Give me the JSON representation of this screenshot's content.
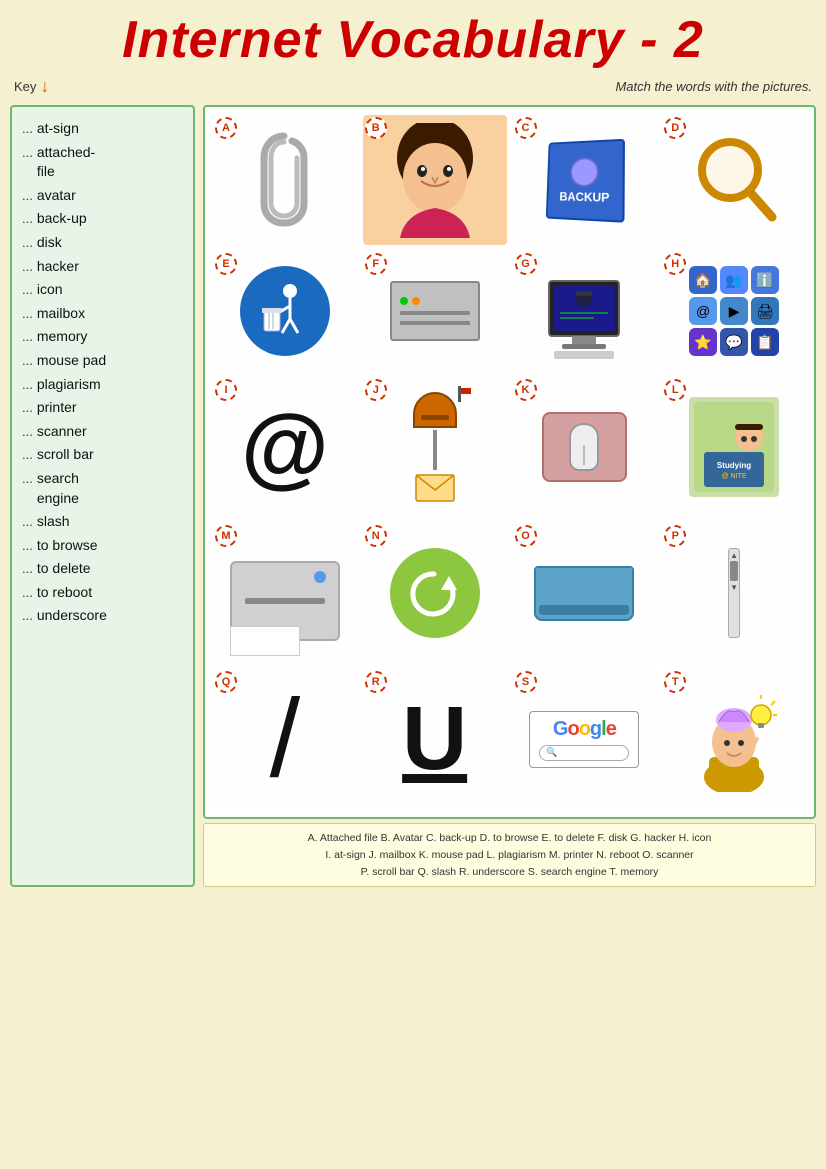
{
  "title": "Internet Vocabulary - 2",
  "key_label": "Key",
  "instruction": "Match the words with the pictures.",
  "vocab_items": [
    "at-sign",
    "attached-file",
    "avatar",
    "back-up",
    "disk",
    "hacker",
    "icon",
    "mailbox",
    "memory",
    "mouse pad",
    "plagiarism",
    "printer",
    "scanner",
    "scroll bar",
    "search engine",
    "slash",
    "to browse",
    "to delete",
    "to reboot",
    "underscore"
  ],
  "cell_labels": [
    "A",
    "B",
    "C",
    "D",
    "E",
    "F",
    "G",
    "H",
    "I",
    "J",
    "K",
    "L",
    "M",
    "N",
    "O",
    "P",
    "Q",
    "R",
    "S",
    "T"
  ],
  "answer_key_lines": [
    "A. Attached file   B. Avatar   C. back-up   D. to browse   E. to delete   F. disk   G. hacker   H. icon",
    "I. at-sign   J. mailbox   K. mouse pad   L. plagiarism   M. printer   N. reboot   O. scanner",
    "P. scroll bar   Q. slash   R. underscore   S. search engine   T. memory"
  ],
  "dots": "...",
  "colors": {
    "title_red": "#cc0000",
    "border_green": "#6db86d",
    "bg_left": "#e8f4e8",
    "bg_page": "#f5f0d0",
    "label_red": "#cc3300",
    "accent_blue": "#1a6bbf",
    "accent_green": "#8dc63f"
  }
}
